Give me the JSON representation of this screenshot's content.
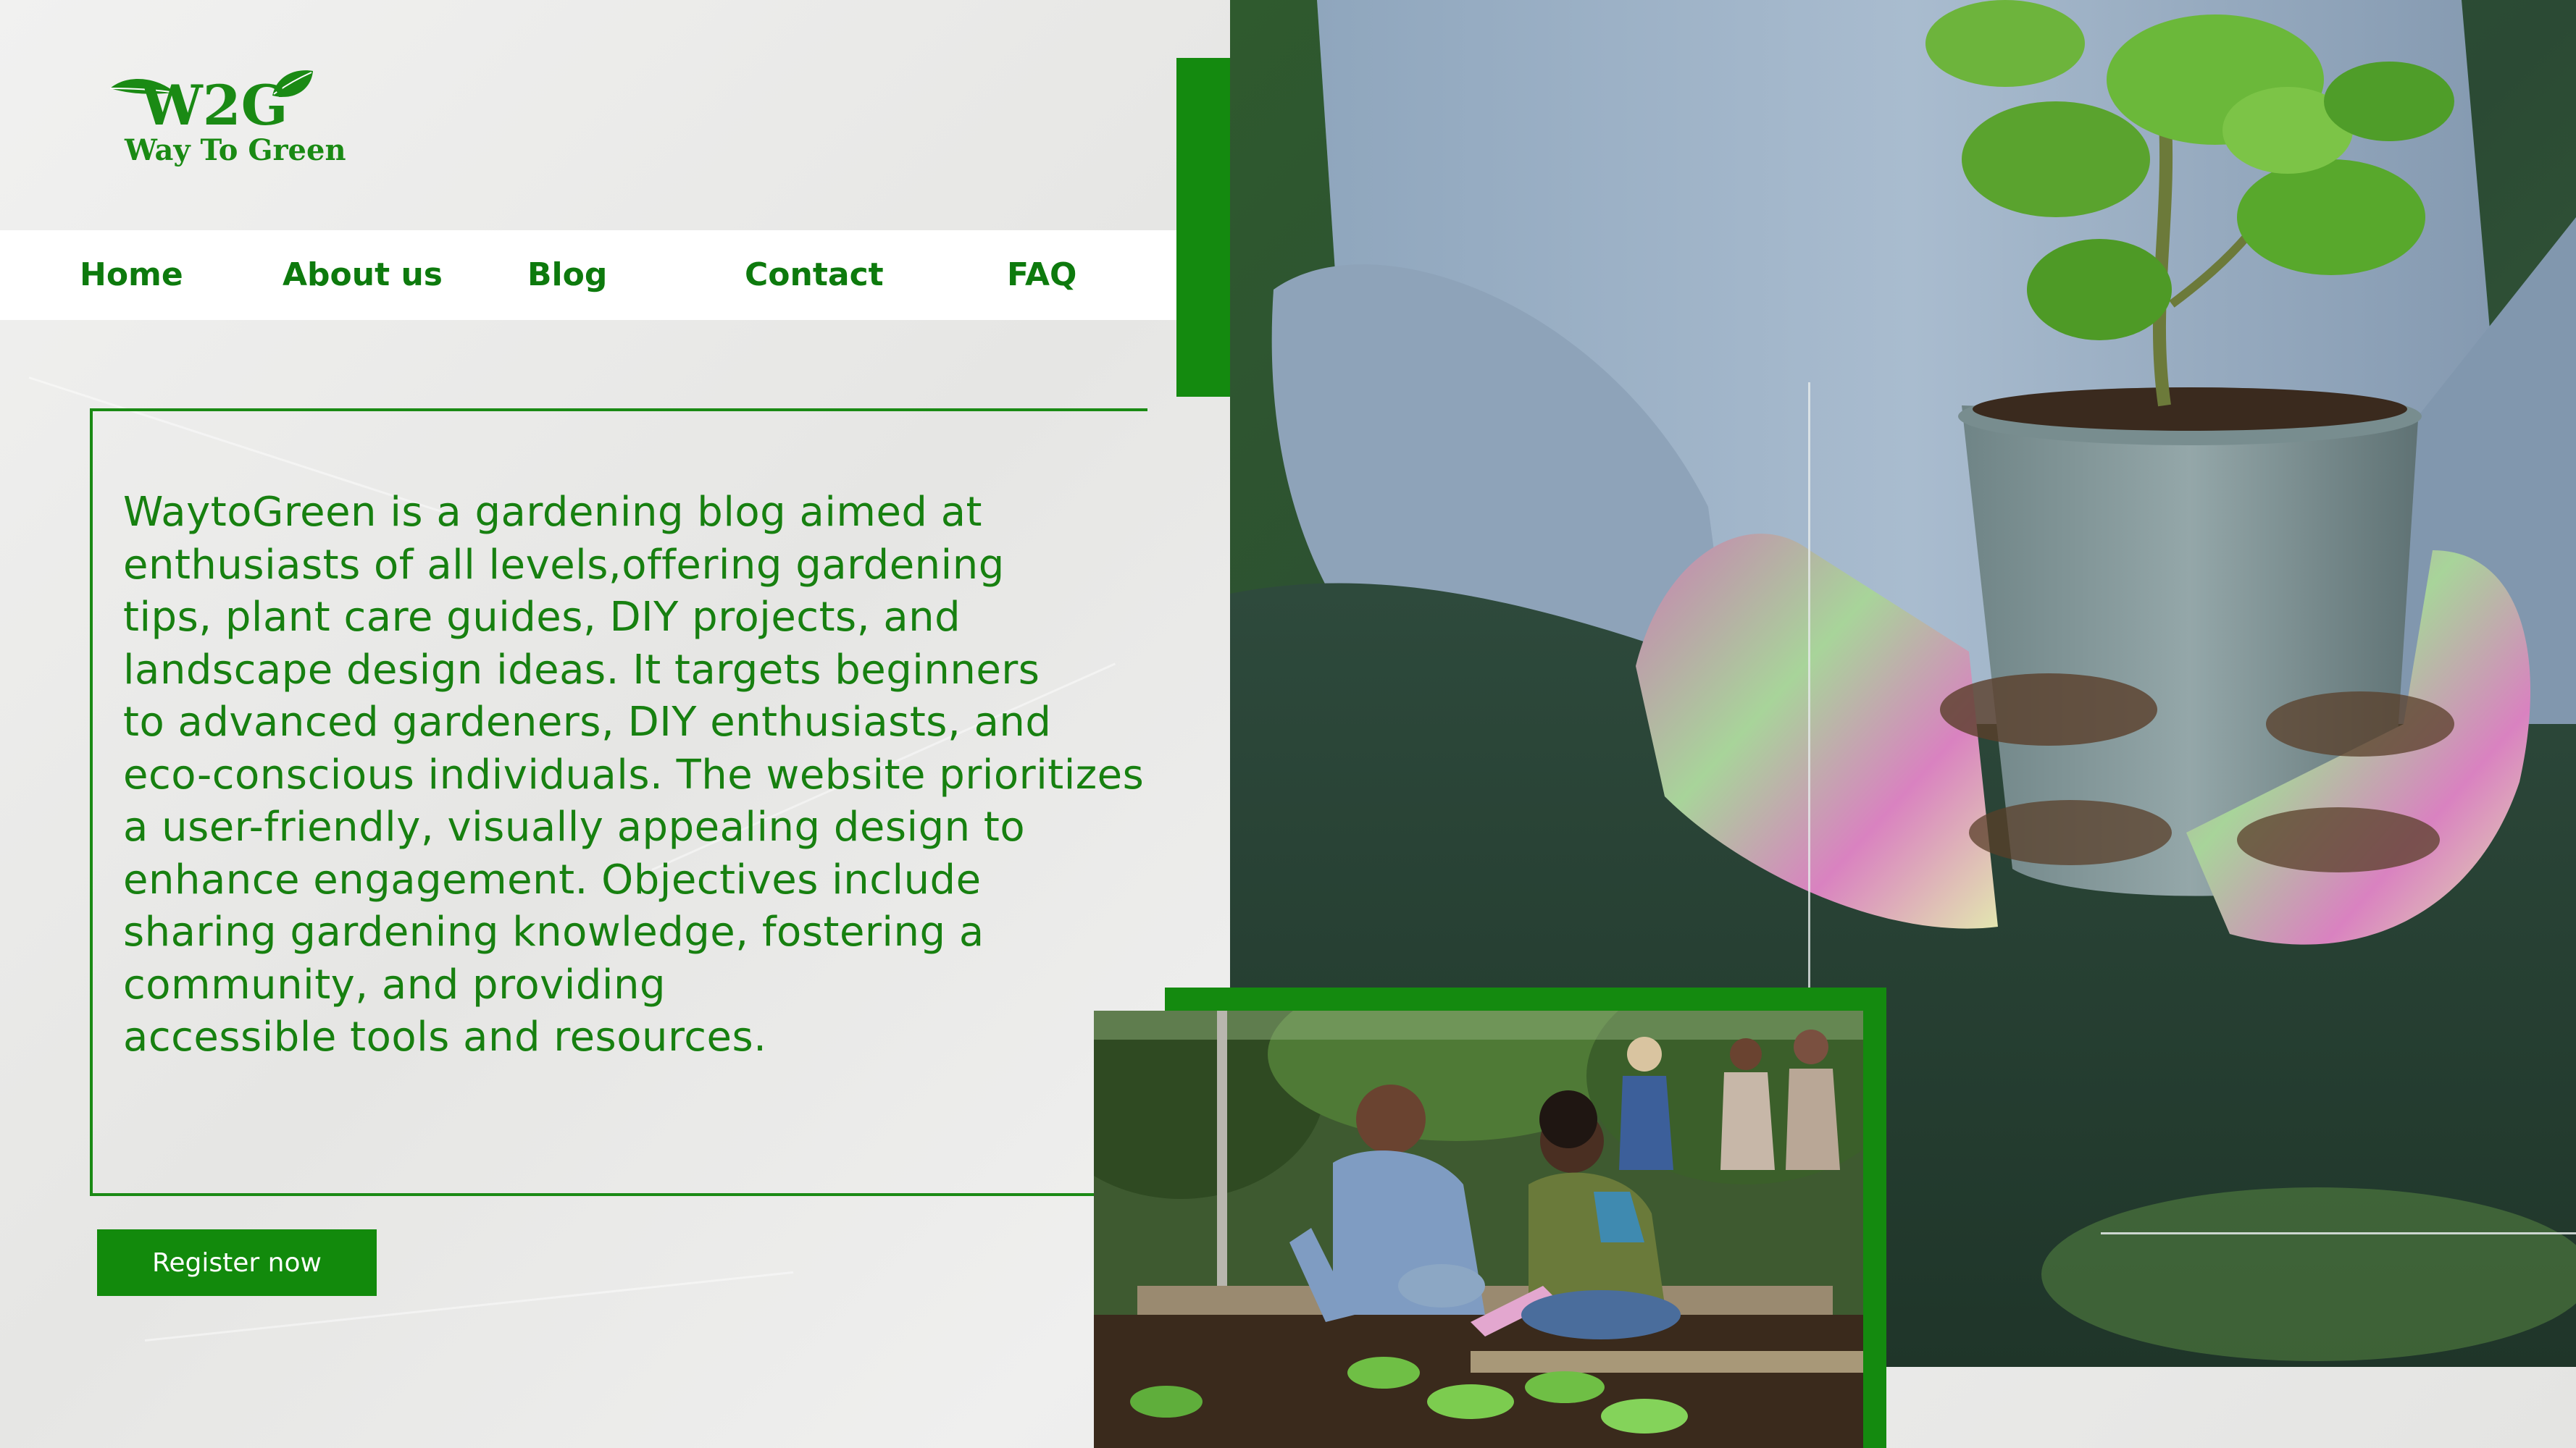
{
  "brand": {
    "logo_mark_text": "W2G",
    "name": "Way To Green"
  },
  "nav": {
    "items": [
      {
        "label": "Home"
      },
      {
        "label": "About us"
      },
      {
        "label": "Blog"
      },
      {
        "label": "Contact"
      },
      {
        "label": "FAQ"
      }
    ]
  },
  "main": {
    "description_lines": [
      "WaytoGreen is a gardening blog aimed at",
      "enthusiasts of all levels,offering gardening",
      "tips, plant care guides, DIY projects, and",
      "landscape design ideas. It targets beginners",
      "to advanced gardeners, DIY enthusiasts, and",
      "eco-conscious individuals. The website prioritizes",
      "a user-friendly, visually appealing design to",
      "enhance engagement. Objectives include",
      "sharing gardening knowledge, fostering a",
      "community, and providing",
      "accessible tools and resources."
    ],
    "register_label": "Register now"
  },
  "colors": {
    "brand_green": "#148a0f",
    "text_green": "#178010",
    "background": "#ebebea"
  },
  "images": {
    "hero": "hands-holding-potted-plant-photo",
    "secondary": "community-garden-planting-photo"
  }
}
